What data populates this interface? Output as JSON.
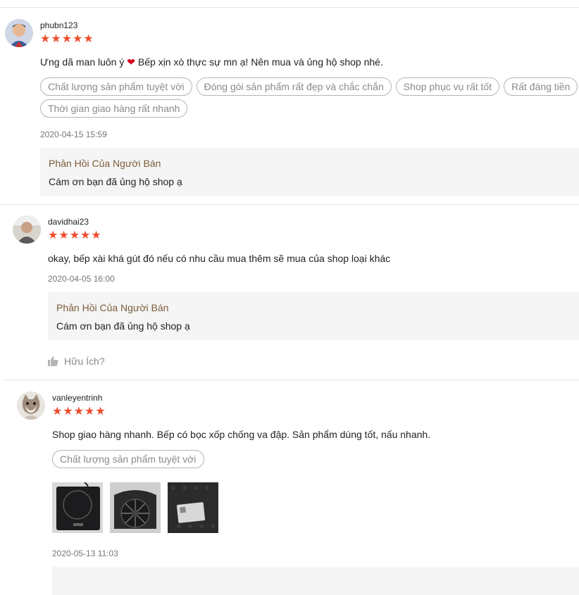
{
  "reviews": [
    {
      "username": "phubn123",
      "stars": "★★★★★",
      "comment_before": "Ưng dã man luôn ý ",
      "comment_after": " Bếp xịn xò thực sự mn ạ! Nên mua và ủng hộ shop nhé.",
      "heart": "❤",
      "tags": [
        "Chất lượng sản phẩm tuyệt vời",
        "Đóng gói sản phẩm rất đẹp và chắc chắn",
        "Shop phục vụ rất tốt",
        "Rất đáng tiền",
        "Thời gian giao hàng rất nhanh"
      ],
      "date": "2020-04-15 15:59",
      "reply_title": "Phản Hồi Của Người Bán",
      "reply_text": "Cám ơn bạn đã ủng hộ shop ạ"
    },
    {
      "username": "davidhai23",
      "stars": "★★★★★",
      "comment": "okay, bếp xài khá gút đó nếu có nhu cầu mua thêm sẽ mua của shop loại khác",
      "date": "2020-04-05 16:00",
      "reply_title": "Phản Hồi Của Người Bán",
      "reply_text": "Cám ơn bạn đã ủng hộ shop ạ",
      "helpful": "Hữu Ích?"
    },
    {
      "username": "vanleyentrinh",
      "stars": "★★★★★",
      "comment": "Shop giao hàng nhanh. Bếp có bọc xốp chống va đập. Sản phẩm dùng tốt, nấu nhanh.",
      "tags": [
        "Chất lượng sản phẩm tuyệt vời"
      ],
      "date": "2020-05-13 11:03"
    }
  ]
}
